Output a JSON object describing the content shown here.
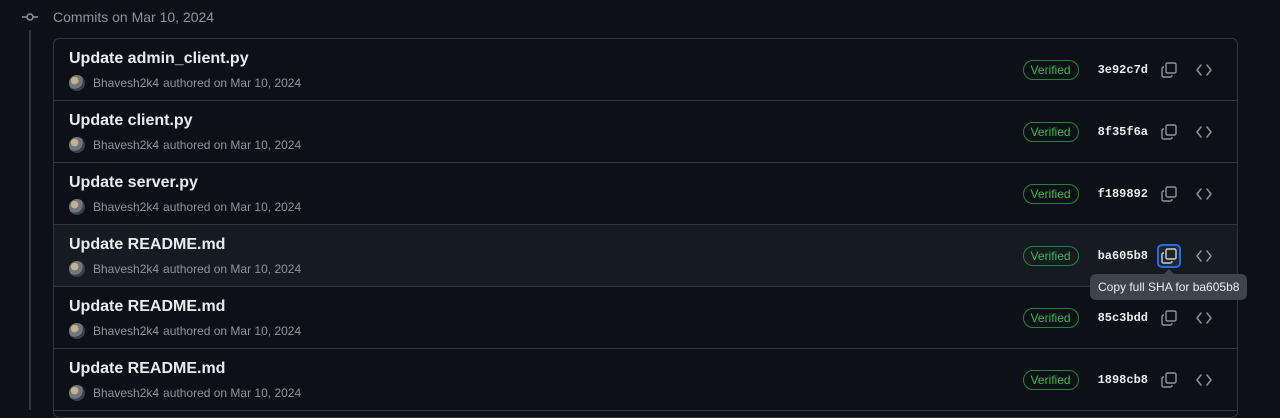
{
  "group": {
    "title": "Commits on Mar 10, 2024",
    "icon": "git-commit-icon"
  },
  "commits": [
    {
      "title": "Update admin_client.py",
      "author": "Bhavesh2k4",
      "authored_text": "authored on Mar 10, 2024",
      "badge": "Verified",
      "sha": "3e92c7d"
    },
    {
      "title": "Update client.py",
      "author": "Bhavesh2k4",
      "authored_text": "authored on Mar 10, 2024",
      "badge": "Verified",
      "sha": "8f35f6a"
    },
    {
      "title": "Update server.py",
      "author": "Bhavesh2k4",
      "authored_text": "authored on Mar 10, 2024",
      "badge": "Verified",
      "sha": "f189892"
    },
    {
      "title": "Update README.md",
      "author": "Bhavesh2k4",
      "authored_text": "authored on Mar 10, 2024",
      "badge": "Verified",
      "sha": "ba605b8"
    },
    {
      "title": "Update README.md",
      "author": "Bhavesh2k4",
      "authored_text": "authored on Mar 10, 2024",
      "badge": "Verified",
      "sha": "85c3bdd"
    },
    {
      "title": "Update README.md",
      "author": "Bhavesh2k4",
      "authored_text": "authored on Mar 10, 2024",
      "badge": "Verified",
      "sha": "1898cb8"
    }
  ],
  "tooltip": {
    "text": "Copy full SHA for ba605b8"
  },
  "colors": {
    "background": "#0d1117",
    "verified": "#3fb950",
    "focus": "#1f6feb"
  }
}
